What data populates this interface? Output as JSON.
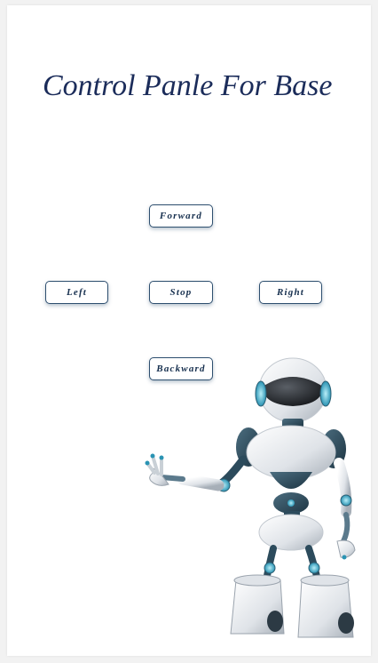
{
  "page": {
    "title": "Control Panle For Base"
  },
  "controls": {
    "forward_label": "Forward",
    "left_label": "Left",
    "stop_label": "Stop",
    "right_label": "Right",
    "backward_label": "Backward"
  },
  "colors": {
    "title": "#1b2c5a",
    "button_border": "#2e4f6f",
    "button_text": "#17304f",
    "background": "#ffffff",
    "page_background": "#f2f2f2"
  },
  "icons": {
    "illustration": "robot-icon"
  }
}
